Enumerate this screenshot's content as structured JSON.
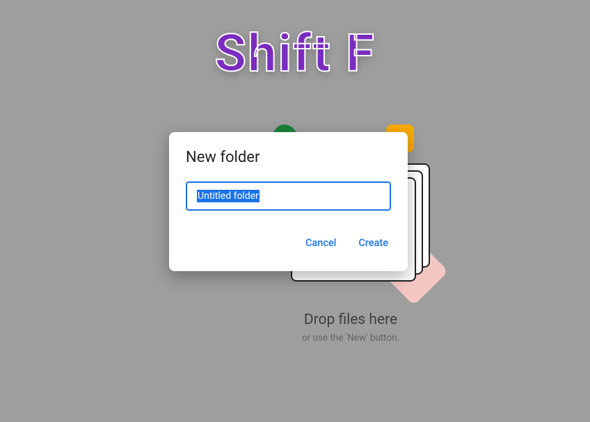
{
  "overlay": {
    "title": "Shift F"
  },
  "background": {
    "drop_title": "Drop files here",
    "drop_subtitle": "or use the 'New' button."
  },
  "modal": {
    "title": "New folder",
    "input_value": "Untitled folder",
    "buttons": {
      "cancel": "Cancel",
      "create": "Create"
    }
  }
}
